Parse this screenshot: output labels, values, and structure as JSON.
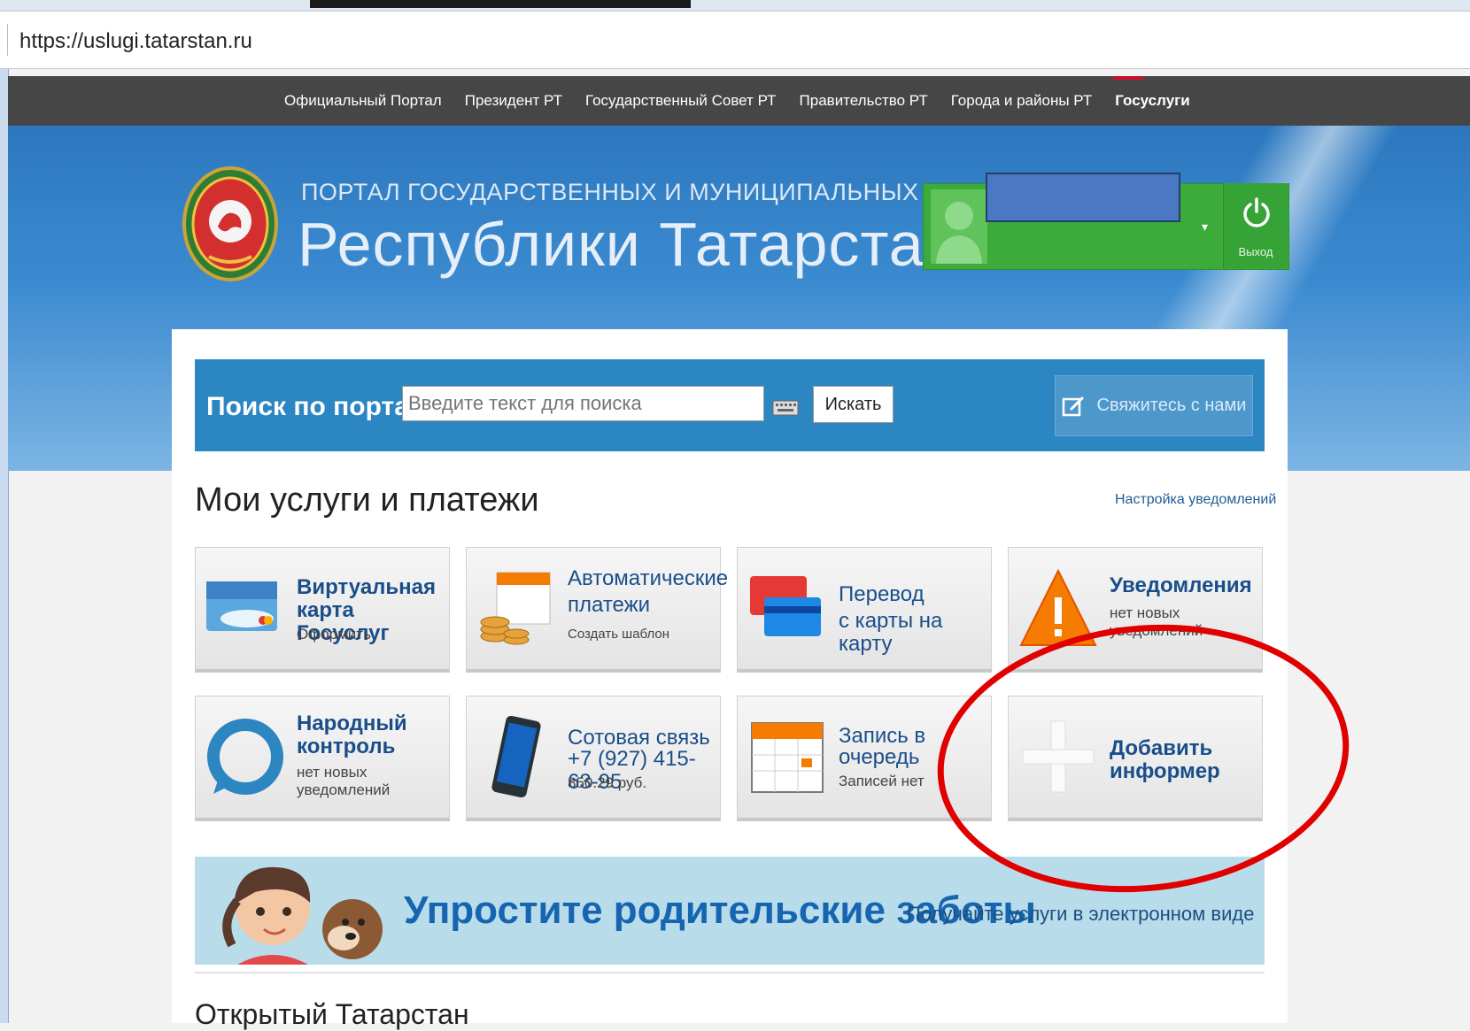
{
  "browser": {
    "url": "https://uslugi.tatarstan.ru"
  },
  "topnav": {
    "items": [
      {
        "label": "Официальный Портал"
      },
      {
        "label": "Президент РТ"
      },
      {
        "label": "Государственный Совет РТ"
      },
      {
        "label": "Правительство РТ"
      },
      {
        "label": "Города и районы РТ"
      },
      {
        "label": "Госуслуги"
      }
    ],
    "active": "Госуслуги",
    "accent_color": "#c8102e"
  },
  "header": {
    "subtitle": "ПОРТАЛ ГОСУДАРСТВЕННЫХ И МУНИЦИПАЛЬНЫХ УСЛУГ",
    "title": "Республики Татарстан",
    "logo_icon": "tatarstan-emblem-icon"
  },
  "user": {
    "avatar_icon": "user-avatar-icon",
    "logout_label": "Выход",
    "box_color": "#3cab3a"
  },
  "search": {
    "label": "Поиск по порталу:",
    "placeholder": "Введите текст для поиска",
    "button": "Искать",
    "contact_label": "Свяжитесь с нами"
  },
  "services": {
    "title": "Мои услуги и платежи",
    "settings_link": "Настройка уведомлений",
    "tiles": [
      {
        "title1": "Виртуальная",
        "title2": "карта Госуслуг",
        "sub1": "Оформить",
        "sub2": "",
        "icon": "card-icon"
      },
      {
        "title1": "Автоматические",
        "title2": "платежи",
        "sub1": "Создать шаблон",
        "sub2": "",
        "icon": "coins-calendar-icon"
      },
      {
        "title1": "Перевод",
        "title2": "с карты на карту",
        "sub1": "",
        "sub2": "",
        "icon": "card-transfer-icon"
      },
      {
        "title1": "Уведомления",
        "title2": "",
        "sub1": "нет новых",
        "sub2": "уведомлений",
        "icon": "warning-icon"
      },
      {
        "title1": "Народный",
        "title2": "контроль",
        "sub1": "нет новых",
        "sub2": "уведомлений",
        "icon": "chat-bubble-icon"
      },
      {
        "title1": "Сотовая связь",
        "title2": "+7 (927) 415-63-95",
        "sub1": "850.29 руб.",
        "sub2": "",
        "icon": "phone-icon"
      },
      {
        "title1": "Запись в",
        "title2": "очередь",
        "sub1": "Записей нет",
        "sub2": "",
        "icon": "calendar-icon"
      },
      {
        "title1": "Добавить",
        "title2": "информер",
        "sub1": "",
        "sub2": "",
        "icon": "plus-icon"
      }
    ]
  },
  "banner": {
    "title": "Упростите родительские заботы",
    "subtitle": "Получайте услуги в электронном виде"
  },
  "footer": {
    "next_section": "Открытый Татарстан"
  },
  "annotation": {
    "color": "#e00000"
  }
}
